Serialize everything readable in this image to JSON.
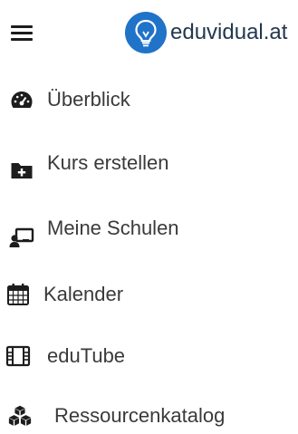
{
  "header": {
    "brand": "eduvidual.at"
  },
  "nav": {
    "items": [
      {
        "label": "Überblick",
        "icon": "dashboard-icon"
      },
      {
        "label": "Kurs erstellen",
        "icon": "folder-plus-icon"
      },
      {
        "label": "Meine Schulen",
        "icon": "chalkboard-teacher-icon"
      },
      {
        "label": "Kalender",
        "icon": "calendar-icon"
      },
      {
        "label": "eduTube",
        "icon": "film-icon"
      },
      {
        "label": "Ressourcenkatalog",
        "icon": "cubes-icon"
      }
    ]
  },
  "colors": {
    "brand_blue": "#1f73c8",
    "text": "#3a3a3a",
    "icon": "#1d1d1d"
  }
}
